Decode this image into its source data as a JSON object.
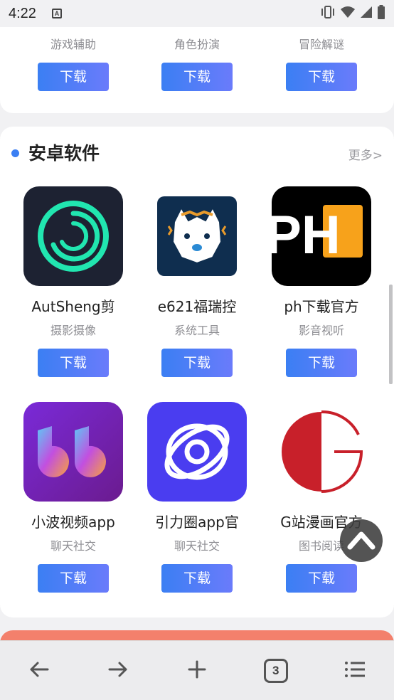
{
  "status_bar": {
    "time": "4:22",
    "notification_icon": "text-a-icon",
    "icons": [
      "vibrate-icon",
      "wifi-icon",
      "signal-icon",
      "battery-icon"
    ]
  },
  "prev_section": {
    "apps": [
      {
        "category": "游戏辅助",
        "download_label": "下载"
      },
      {
        "category": "角色扮演",
        "download_label": "下载"
      },
      {
        "category": "冒险解谜",
        "download_label": "下载"
      }
    ]
  },
  "section": {
    "title": "安卓软件",
    "more_label": "更多>",
    "accent_color": "#3b7ff3",
    "apps": [
      {
        "name": "AutSheng剪",
        "category": "摄影摄像",
        "download_label": "下载",
        "icon": "autsheng-app-icon"
      },
      {
        "name": "e621福瑞控",
        "category": "系统工具",
        "download_label": "下载",
        "icon": "e621-app-icon"
      },
      {
        "name": "ph下载官方",
        "category": "影音视听",
        "download_label": "下载",
        "icon": "ph-app-icon",
        "icon_text": "PH"
      },
      {
        "name": "小波视频app",
        "category": "聊天社交",
        "download_label": "下载",
        "icon": "xiaobo-app-icon"
      },
      {
        "name": "引力圈app官",
        "category": "聊天社交",
        "download_label": "下载",
        "icon": "yinliquan-app-icon"
      },
      {
        "name": "G站漫画官方",
        "category": "图书阅读",
        "download_label": "下载",
        "icon": "gzhan-app-icon"
      }
    ]
  },
  "bottom_nav": {
    "tab_count": "3",
    "items": [
      "back-arrow-icon",
      "forward-arrow-icon",
      "plus-icon",
      "tabs-icon",
      "menu-icon"
    ]
  }
}
